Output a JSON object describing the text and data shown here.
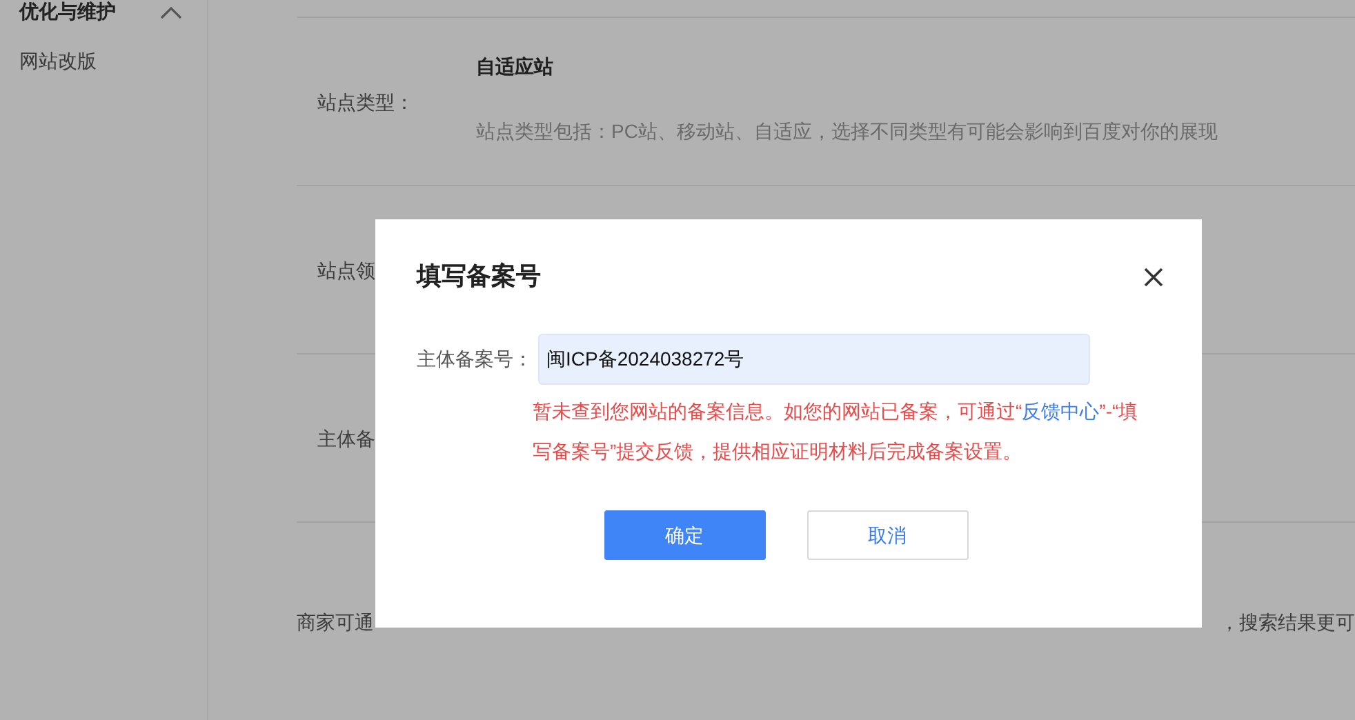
{
  "sidebar": {
    "section": {
      "title": "优化与维护",
      "expanded": true
    },
    "items": [
      {
        "label": "网站改版"
      }
    ]
  },
  "rows": [
    {
      "label": "站点类型：",
      "value": "自适应站",
      "hint": "站点类型包括：PC站、移动站、自适应，选择不同类型有可能会影响到百度对你的展现"
    },
    {
      "label": "站点领"
    },
    {
      "label": "主体备"
    }
  ],
  "footer_text": {
    "left": "商家可通",
    "right": "，搜索结果更可"
  },
  "dialog": {
    "title": "填写备案号",
    "field": {
      "label": "主体备案号：",
      "value": "闽ICP备2024038272号"
    },
    "error": {
      "before": "暂未查到您网站的备案信息。如您的网站已备案，可通过“",
      "link": "反馈中心",
      "after": "”-“填写备案号”提交反馈，提供相应证明材料后完成备案设置。"
    },
    "buttons": [
      {
        "label": "确定",
        "kind": "primary"
      },
      {
        "label": "取消",
        "kind": "secondary"
      }
    ]
  }
}
